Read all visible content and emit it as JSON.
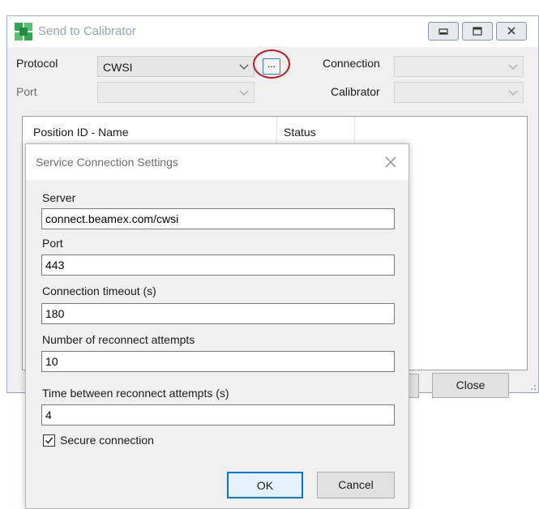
{
  "main_window": {
    "title": "Send to Calibrator",
    "protocol_label": "Protocol",
    "protocol_value": "CWSI",
    "ellipsis_label": "...",
    "connection_label": "Connection",
    "port_label": "Port",
    "calibrator_label": "Calibrator",
    "list_columns": [
      "Position ID - Name",
      "Status"
    ],
    "close_button": "Close"
  },
  "dialog": {
    "title": "Service Connection Settings",
    "fields": [
      {
        "label": "Server",
        "value": "connect.beamex.com/cwsi"
      },
      {
        "label": "Port",
        "value": "443"
      },
      {
        "label": "Connection timeout (s)",
        "value": "180"
      },
      {
        "label": "Number of reconnect attempts",
        "value": "10"
      },
      {
        "label": "Time between reconnect attempts (s)",
        "value": "4"
      }
    ],
    "secure_connection_label": "Secure connection",
    "secure_connection_checked": true,
    "ok_button": "OK",
    "cancel_button": "Cancel"
  },
  "colors": {
    "highlight_ring": "#c0192a",
    "focus_blue": "#0078d7",
    "app_icon_green": "#2fa84f"
  },
  "icons": {
    "app": "beamex-app-icon",
    "minimize": "minimize-icon",
    "maximize": "maximize-icon",
    "close": "close-icon",
    "dropdown": "chevron-down-icon",
    "checkmark": "checkmark-icon",
    "resize_grip": "resize-grip-icon"
  }
}
